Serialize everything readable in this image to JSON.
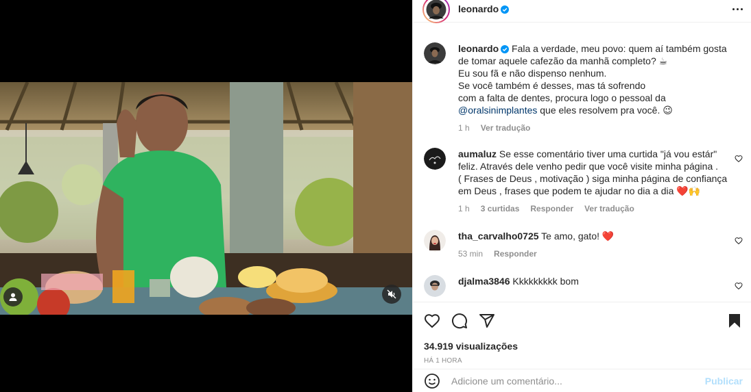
{
  "post": {
    "author": "leonardo",
    "verified": true,
    "views_label": "34.919 visualizações",
    "time_label": "HÁ 1 HORA"
  },
  "caption": {
    "username": "leonardo",
    "lines": [
      "Fala a verdade, meu povo: quem aí também gosta",
      "de tomar aquele cafezão da manhã completo? ☕",
      "Eu sou fã e não dispenso nenhum.",
      "Se você também é desses, mas tá sofrendo",
      "com a falta de dentes, procura logo o pessoal da"
    ],
    "mention": "@oralsinimplantes",
    "end_text": " que eles resolvem pra você. 😉",
    "age": "1 h",
    "translate": "Ver tradução"
  },
  "comments": [
    {
      "username": "aumaluz",
      "lines": [
        "Se esse comentário tiver uma curtida \"já vou estár\"",
        "feliz. Através dele venho pedir que  você visite minha página .",
        "( Frases de Deus , motivação ) siga minha página de confiança",
        "em Deus , frases que podem te ajudar no dia a dia  ❤️🙌"
      ],
      "age": "1 h",
      "likes": "3 curtidas",
      "reply": "Responder",
      "translate": "Ver tradução"
    },
    {
      "username": "tha_carvalho0725",
      "text": "Te amo, gato! ❤️",
      "age": "53 min",
      "reply": "Responder"
    },
    {
      "username": "djalma3846",
      "text": "Kkkkkkkkk bom"
    }
  ],
  "composer": {
    "placeholder": "Adicione um comentário...",
    "publish": "Publicar"
  },
  "colors": {
    "verified": "#0095f6",
    "link": "#00376b",
    "muted": "#8e8e8e",
    "publish_disabled": "#b2dffc",
    "heart_red": "#ed4956"
  }
}
